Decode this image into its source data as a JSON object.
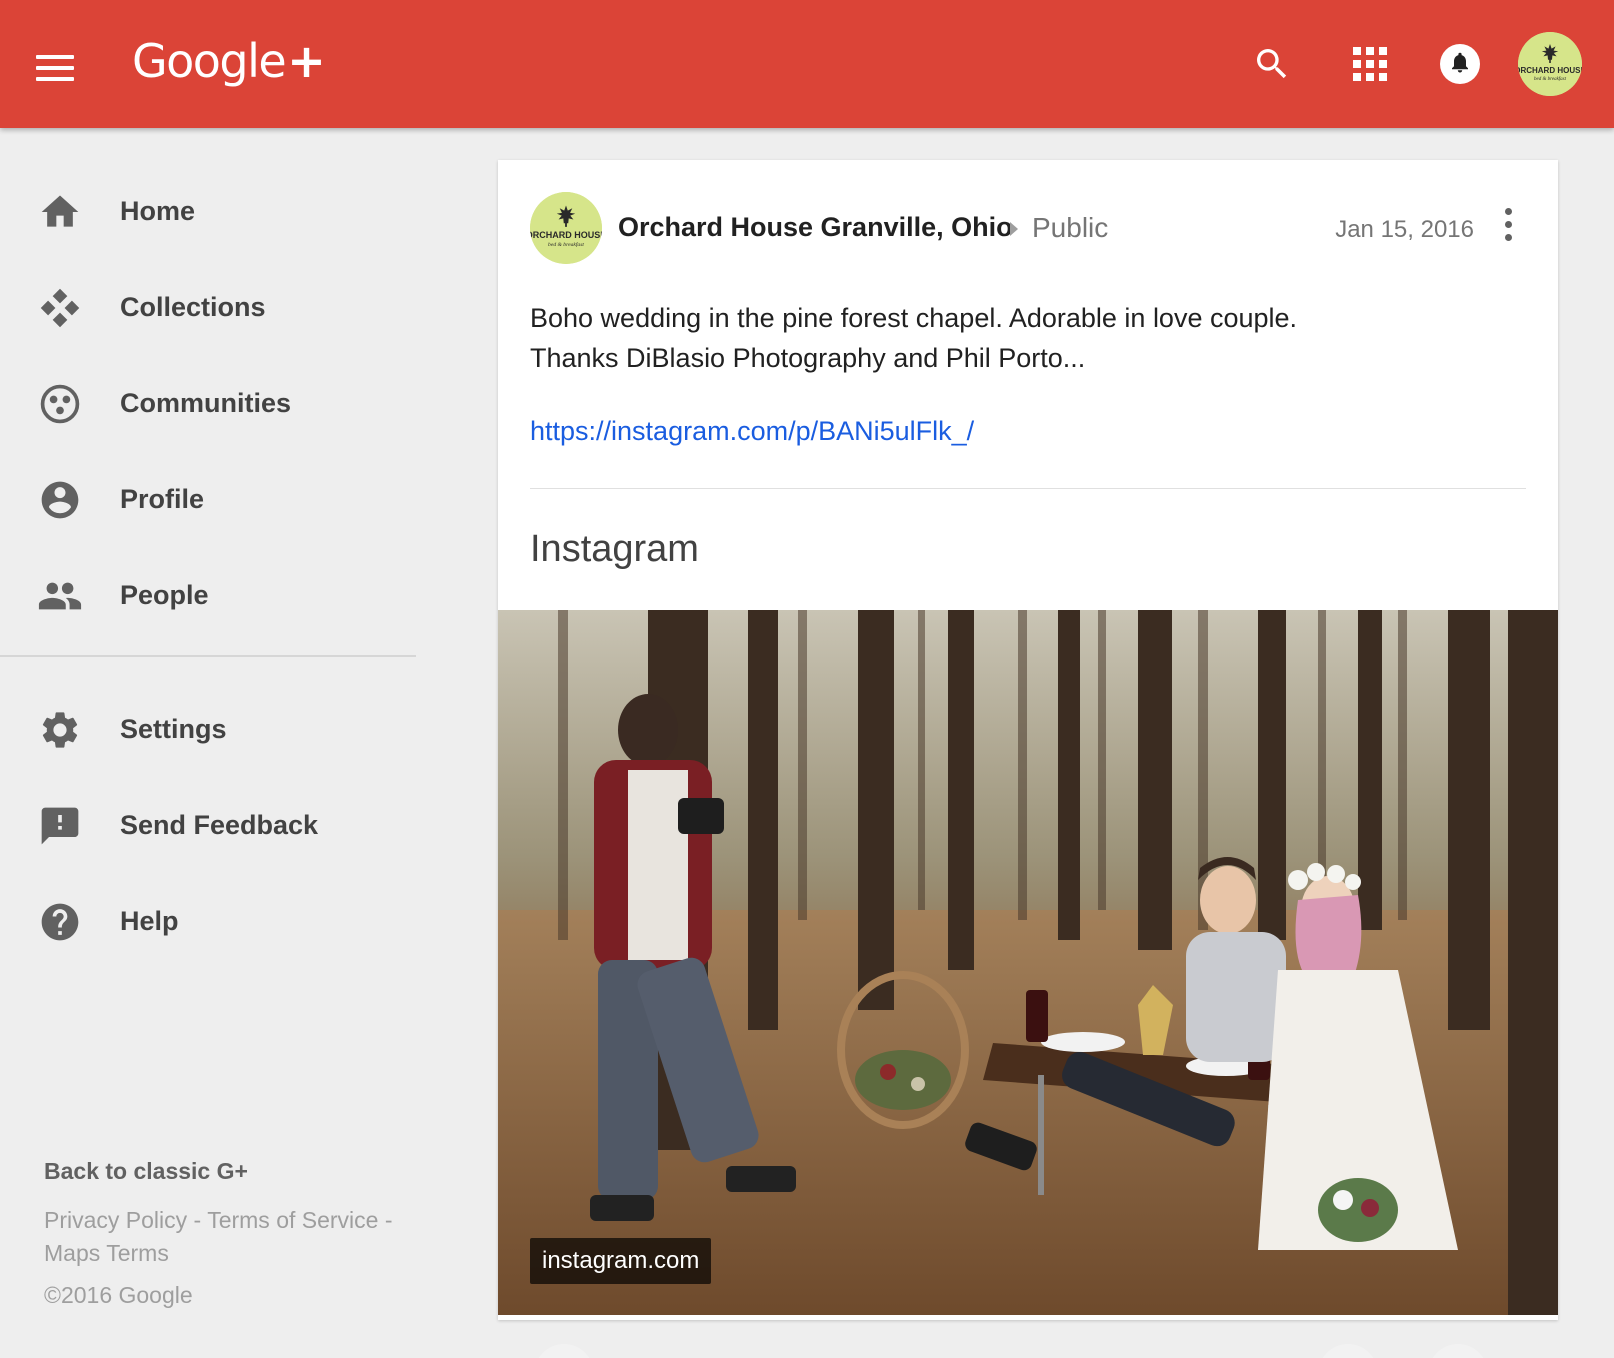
{
  "app": {
    "logo_text": "Google",
    "logo_plus": "+"
  },
  "header": {
    "icons": [
      "search-icon",
      "apps-grid-icon",
      "notifications-icon",
      "account-avatar"
    ],
    "brand_color": "#db4437"
  },
  "avatar": {
    "line1": "ORCHARD HOUSE",
    "line2": "bed & breakfast"
  },
  "sidebar": {
    "items": [
      {
        "label": "Home",
        "icon": "home-icon"
      },
      {
        "label": "Collections",
        "icon": "collections-icon"
      },
      {
        "label": "Communities",
        "icon": "communities-icon"
      },
      {
        "label": "Profile",
        "icon": "profile-icon"
      },
      {
        "label": "People",
        "icon": "people-icon"
      }
    ],
    "secondary": [
      {
        "label": "Settings",
        "icon": "settings-icon"
      },
      {
        "label": "Send Feedback",
        "icon": "feedback-icon"
      },
      {
        "label": "Help",
        "icon": "help-icon"
      }
    ],
    "footer": {
      "classic": "Back to classic G+",
      "privacy": "Privacy Policy",
      "sep1": " - ",
      "terms": "Terms of Service",
      "sep2": " - ",
      "maps": "Maps Terms",
      "copyright": "©2016 Google"
    }
  },
  "post": {
    "author": "Orchard House Granville, Ohio",
    "visibility": "Public",
    "date": "Jan 15, 2016",
    "text_line1": "Boho wedding in the pine forest chapel. Adorable in love couple.",
    "text_line2": "Thanks DiBlasio Photography and Phil Porto...",
    "link": "https://instagram.com/p/BANi5ulFlk_/",
    "embed_title": "Instagram",
    "image_source": "instagram.com",
    "link_color": "#1a5de0"
  }
}
